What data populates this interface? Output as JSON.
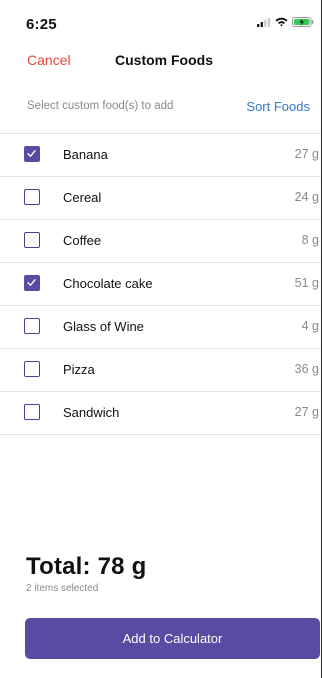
{
  "status_bar": {
    "time": "6:25",
    "icons": [
      "signal-icon",
      "wifi-icon",
      "battery-icon"
    ],
    "battery_color": "#35c759"
  },
  "nav": {
    "cancel_label": "Cancel",
    "title": "Custom Foods"
  },
  "list_header": {
    "hint": "Select custom food(s) to add",
    "sort_label": "Sort Foods"
  },
  "foods": [
    {
      "name": "Banana",
      "amount": "27 g",
      "checked": true
    },
    {
      "name": "Cereal",
      "amount": "24 g",
      "checked": false
    },
    {
      "name": "Coffee",
      "amount": "8 g",
      "checked": false
    },
    {
      "name": "Chocolate cake",
      "amount": "51 g",
      "checked": true
    },
    {
      "name": "Glass of Wine",
      "amount": "4 g",
      "checked": false
    },
    {
      "name": "Pizza",
      "amount": "36 g",
      "checked": false
    },
    {
      "name": "Sandwich",
      "amount": "27 g",
      "checked": false
    }
  ],
  "summary": {
    "total": "Total: 78 g",
    "selected": "2 items selected"
  },
  "actions": {
    "add_label": "Add to Calculator"
  },
  "colors": {
    "accent": "#5b4aa2",
    "cancel": "#e5453a",
    "link": "#3478c6",
    "muted": "#8a8a8e"
  }
}
